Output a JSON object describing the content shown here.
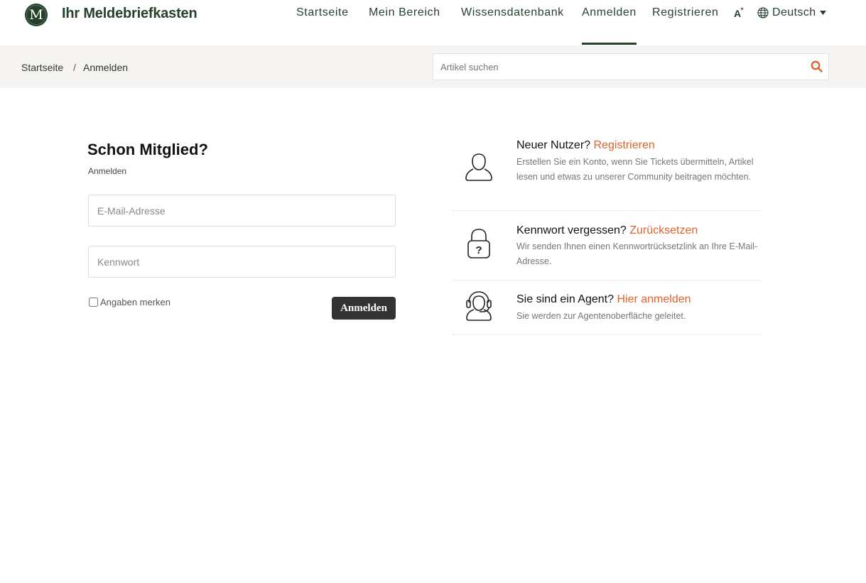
{
  "header": {
    "logo_letter": "M",
    "brand": "Ihr Meldebriefkasten",
    "nav": [
      "Startseite",
      "Mein Bereich",
      "Wissensdatenbank",
      "Anmelden",
      "Registrieren"
    ],
    "active_nav": "Anmelden",
    "font_size_icon": "A",
    "language": "Deutsch"
  },
  "breadcrumb": {
    "items": [
      "Startseite",
      "Anmelden"
    ],
    "separator": "/"
  },
  "search": {
    "placeholder": "Artikel suchen"
  },
  "login": {
    "title": "Schon Mitglied?",
    "subtitle": "Anmelden",
    "email_placeholder": "E-Mail-Adresse",
    "password_placeholder": "Kennwort",
    "remember_label": "Angaben merken",
    "remember_checked": false,
    "submit_label": "Anmelden"
  },
  "info": {
    "register": {
      "question": "Neuer Nutzer?",
      "link": "Registrieren",
      "description": "Erstellen Sie ein Konto, wenn Sie Tickets übermitteln, Artikel lesen und etwas zu unserer Community beitragen möchten."
    },
    "reset": {
      "question": "Kennwort vergessen?",
      "link": "Zurücksetzen",
      "description": "Wir senden Ihnen einen Kennwortrücksetzlink an Ihre E-Mail-Adresse."
    },
    "agent": {
      "question": "Sie sind ein Agent?",
      "link": "Hier anmelden",
      "description": "Sie werden zur Agentenoberfläche geleitet."
    }
  },
  "colors": {
    "brand_green": "#27402c",
    "link_orange": "#e0622a",
    "subbar_bg": "#f5f4f2",
    "button_dark": "#333333"
  }
}
